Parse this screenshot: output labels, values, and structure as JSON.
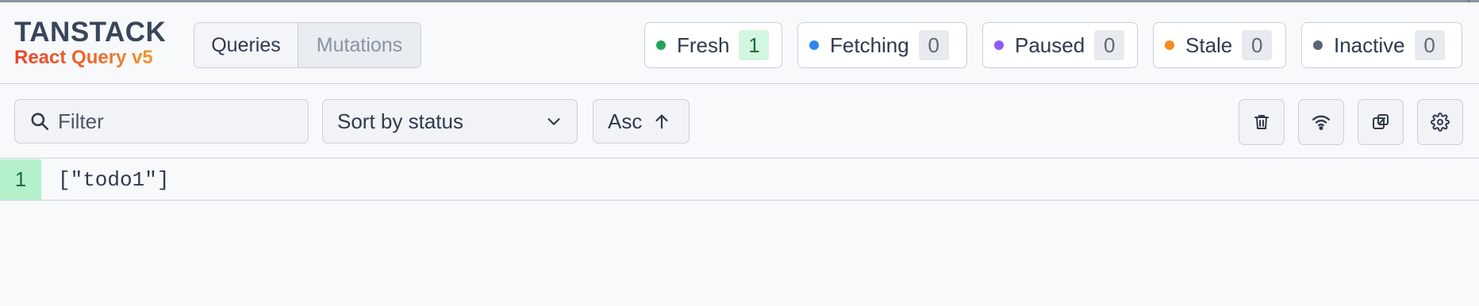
{
  "logo": {
    "title": "TANSTACK",
    "subtitle": "React Query v5"
  },
  "tabs": [
    {
      "label": "Queries",
      "active": true
    },
    {
      "label": "Mutations",
      "active": false
    }
  ],
  "status_badges": [
    {
      "label": "Fresh",
      "count": "1",
      "color": "#22a55b"
    },
    {
      "label": "Fetching",
      "count": "0",
      "color": "#2f87f0"
    },
    {
      "label": "Paused",
      "count": "0",
      "color": "#8b5cf6"
    },
    {
      "label": "Stale",
      "count": "0",
      "color": "#f58a1f"
    },
    {
      "label": "Inactive",
      "count": "0",
      "color": "#5b6474"
    }
  ],
  "toolbar": {
    "filter_placeholder": "Filter",
    "sort_selected": "Sort by status",
    "order_label": "Asc",
    "icons": [
      "trash-icon",
      "wifi-icon",
      "open-in-window-icon",
      "settings-gear-icon"
    ]
  },
  "queries": [
    {
      "observers": "1",
      "key": "[\"todo1\"]",
      "status": "fresh",
      "status_color": "#b4f1cb"
    }
  ]
}
